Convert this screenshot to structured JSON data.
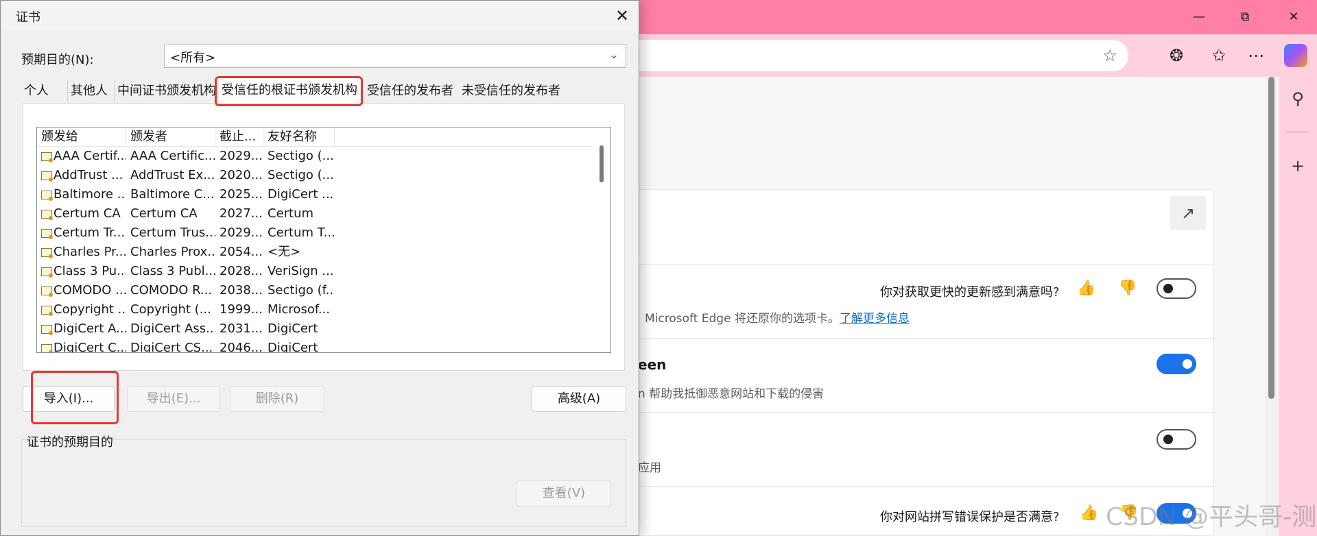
{
  "dialog": {
    "title": "证书",
    "purpose_label": "预期目的(N):",
    "purpose_value": "<所有>",
    "tabs": [
      "个人",
      "其他人",
      "中间证书颁发机构",
      "受信任的根证书颁发机构",
      "受信任的发布者",
      "未受信任的发布者"
    ],
    "active_tab": "受信任的根证书颁发机构",
    "columns": [
      "颁发给",
      "颁发者",
      "截止...",
      "友好名称"
    ],
    "rows": [
      [
        "AAA Certif...",
        "AAA Certific...",
        "2029...",
        "Sectigo (..."
      ],
      [
        "AddTrust ...",
        "AddTrust Ex...",
        "2020...",
        "Sectigo (..."
      ],
      [
        "Baltimore ...",
        "Baltimore C...",
        "2025...",
        "DigiCert ..."
      ],
      [
        "Certum CA",
        "Certum CA",
        "2027...",
        "Certum"
      ],
      [
        "Certum Tr...",
        "Certum Trus...",
        "2029...",
        "Certum T..."
      ],
      [
        "Charles Pr...",
        "Charles Prox...",
        "2054...",
        "<无>"
      ],
      [
        "Class 3 Pu...",
        "Class 3 Publ...",
        "2028...",
        "VeriSign ..."
      ],
      [
        "COMODO ...",
        "COMODO R...",
        "2038...",
        "Sectigo (f..."
      ],
      [
        "Copyright ...",
        "Copyright (...",
        "1999...",
        "Microsof..."
      ],
      [
        "DigiCert A...",
        "DigiCert Ass...",
        "2031...",
        "DigiCert"
      ],
      [
        "DigiCert C...",
        "DigiCert CS...",
        "2046...",
        "DigiCert"
      ]
    ],
    "buttons": {
      "import": "导入(I)...",
      "export": "导出(E)...",
      "remove": "删除(R)",
      "advanced": "高级(A)",
      "view": "查看(V)"
    },
    "purposes_group_label": "证书的预期目的"
  },
  "browser": {
    "feedback_question_1": "你对获取更快的更新感到满意吗?",
    "restore_tabs_text": "Microsoft Edge 将还原你的选项卡。",
    "learn_more": "了解更多信息",
    "smartscreen_title_fragment": "een",
    "smartscreen_desc_fragment": "n 帮助我抵御恶意网站和下载的侵害",
    "app_fragment": "应用",
    "feedback_question_2": "你对网站拼写错误保护是否满意?",
    "toggles": [
      false,
      true,
      false,
      true
    ]
  },
  "watermark": "CSDN @平头哥-测试",
  "colors": {
    "title_bar": "#ff7fa5",
    "toolbar": "#ffd0de",
    "highlight": "#e53935",
    "toggle_on": "#1a73e8"
  }
}
